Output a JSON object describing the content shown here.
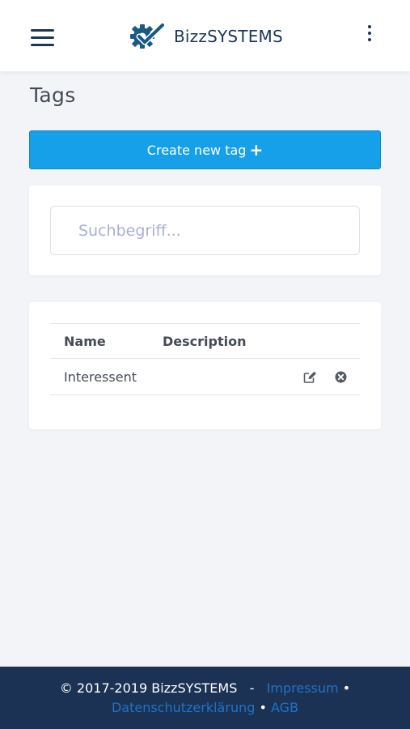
{
  "header": {
    "brand": "BizzSYSTEMS",
    "menu_icon": "hamburger-icon",
    "more_icon": "kebab-vertical-icon",
    "logo_icon": "gear-checkmark-icon",
    "brand_color": "#1a5a82"
  },
  "page": {
    "title": "Tags"
  },
  "create_button": {
    "label": "Create new tag",
    "icon": "+",
    "color": "#16a0ea"
  },
  "search": {
    "placeholder": "Suchbegriff...",
    "value": ""
  },
  "table": {
    "columns": [
      "Name",
      "Description"
    ],
    "rows": [
      {
        "name": "Interessent",
        "description": "",
        "actions": [
          "edit-icon",
          "delete-icon"
        ]
      }
    ]
  },
  "footer": {
    "copyright": "© 2017-2019 BizzSYSTEMS",
    "separator": "-",
    "bullet": "•",
    "links": {
      "impressum": "Impressum",
      "datenschutz": "Datenschutzerklärung",
      "agb": "AGB"
    },
    "background": "#1b3254",
    "link_color": "#1f73c8"
  }
}
